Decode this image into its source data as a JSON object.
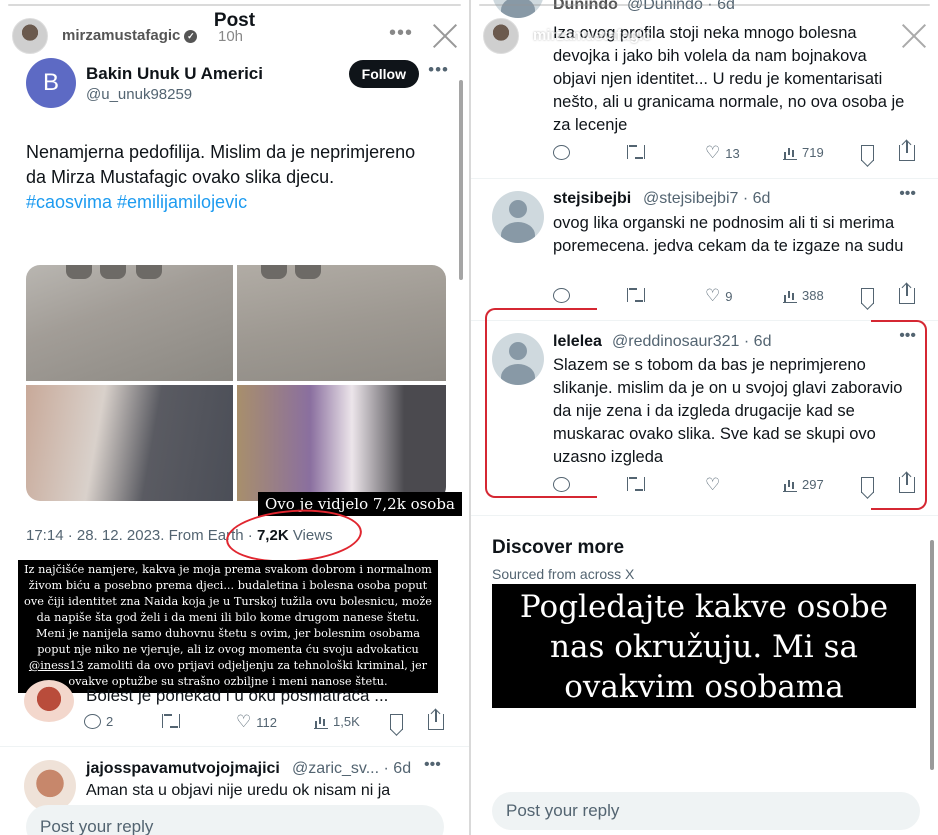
{
  "left": {
    "story": {
      "username": "mirzamustafagic",
      "time": "10h",
      "heading": "Post"
    },
    "tweet": {
      "author_initial": "B",
      "author_name": "Bakin Unuk U Americi",
      "author_handle": "@u_unuk98259",
      "follow_label": "Follow",
      "text": "Nenamjerna pedofilija. Mislim da je neprimjereno da Mirza Mustafagic ovako slika djecu.",
      "hashtags": "#caosvima #emilijamilojevic",
      "media_caption": "Ovo je vidjelo 7,2k osoba",
      "meta_datetime": "17:14 · 28. 12. 2023. From Earth · ",
      "meta_views_count": "7,2K",
      "meta_views_label": " Views"
    },
    "statement_overlay": {
      "text_before_mention": "Iz najčišće namjere, kakva je moja prema svakom dobrom i normalnom živom biću a posebno prema djeci... budaletina i bolesna osoba poput ove čiji identitet zna Naida koja je u Turskoj tužila ovu bolesnicu,  može da napiše šta god želi i da meni ili bilo kome drugom nanese štetu. Meni je nanijela samo duhovnu štetu s ovim, jer bolesnim osobama poput nje niko ne vjeruje, ali iz ovog momenta ću svoju advokaticu ",
      "mention": "@iness13",
      "text_after_mention": " zamoliti da ovo prijavi odjeljenju za tehnološki kriminal, jer ovakve optužbe su strašno ozbiljne i meni nanose štetu."
    },
    "reply1": {
      "text": "Bolest je ponekad i u oku posmatrača ...",
      "replies": "2",
      "likes": "112",
      "views": "1,5K"
    },
    "reply2": {
      "name": "jajosspavamutvojojmajici",
      "handle": "@zaric_sv...",
      "age": "· 6d",
      "text": "Aman sta u objavi nije uredu ok nisam ni ja"
    },
    "reply_placeholder": "Post your reply"
  },
  "right": {
    "story": {
      "username": "mirzamustafagic"
    },
    "reply_top": {
      "name": "Dunindo",
      "handle": "@Dunindo",
      "age": "· 6d",
      "text": "Iza ovog profila stoji neka mnogo bolesna devojka i jako bih volela da nam bojnakova objavi njen identitet... U redu je komentarisati nešto, ali u granicama normale, no ova osoba je za lecenje",
      "likes": "13",
      "views": "719"
    },
    "reply_stej": {
      "name": "stejsibejbi",
      "handle": "@stejsibejbi7",
      "age": "· 6d",
      "text": "ovog lika organski ne podnosim ali ti si merima poremecena. jedva cekam da te izgaze na sudu",
      "likes": "9",
      "views": "388"
    },
    "reply_lelelea": {
      "name": "lelelea",
      "handle": "@reddinosaur321",
      "age": "· 6d",
      "text": "Slazem se s tobom da bas je neprimjereno slikanje. mislim da je on u svojoj glavi zaboravio da nije zena i da izgleda drugacije kad se muskarac ovako slika. Sve kad se skupi ovo uzasno izgleda",
      "likes": "",
      "views": "297"
    },
    "discover": {
      "title": "Discover more",
      "subtitle": "Sourced from across X"
    },
    "overlay_note": "Pogledajte kakve osobe nas okružuju. Mi sa ovakvim osobama udišemo zrak.",
    "reply_placeholder": "Post your reply"
  },
  "icons": [
    "more-icon",
    "close-icon",
    "verified-icon",
    "reply-icon",
    "repost-icon",
    "like-icon",
    "views-icon",
    "bookmark-icon",
    "share-icon"
  ],
  "colors": {
    "link": "#1d9bf0",
    "follow_bg": "#0f1419",
    "annotation_red": "#d52732",
    "avatar_b": "#5d6ac4"
  }
}
